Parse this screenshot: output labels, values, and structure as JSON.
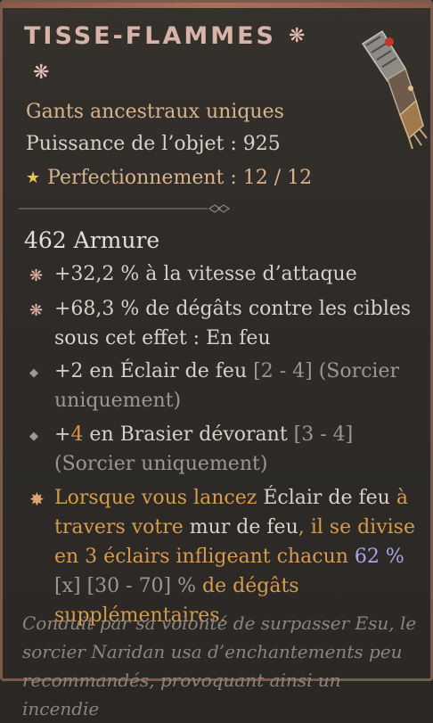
{
  "item": {
    "name": "TISSE-FLAMMES",
    "rarity": "Gants ancestraux uniques",
    "power": "Puissance de l’objet : 925",
    "perfection": "Perfectionnement : 12 / 12"
  },
  "stats": {
    "armor": "462 Armure",
    "attack_speed": "+32,2 % à la vitesse d’attaque",
    "damage_burning": "+68,3 % de dégâts contre les cibles sous cet effet : En feu",
    "skill1": {
      "prefix": "+2 en Éclair de feu",
      "range": " [2 - 4] (Sorcier uniquement)"
    },
    "skill2": {
      "plus": "+",
      "value": "4",
      "rest": " en Brasier dévorant",
      "range": " [3 - 4] (Sorcier uniquement)"
    }
  },
  "unique_power": {
    "p1": "Lorsque vous lancez ",
    "p2": "Éclair de feu",
    "p3": " à travers votre ",
    "p4": "mur de feu",
    "p5": ", il se divise en 3 éclairs infligeant chacun ",
    "p6": "62 %",
    "p7": "[x] [30 - 70] %",
    "p8": " de dégâts supplémentaires."
  },
  "flavor": "Conduit par sa volonté de surpasser Esu, le sorcier Naridan usa d’enchantements peu recommandés, provoquant ainsi un incendie",
  "icons": {
    "mythic": "flower-icon",
    "perfection": "star-icon"
  },
  "colors": {
    "rarity": "#d9b48a",
    "affix_text": "#d7d1c8",
    "unique_text": "#e0953c"
  }
}
